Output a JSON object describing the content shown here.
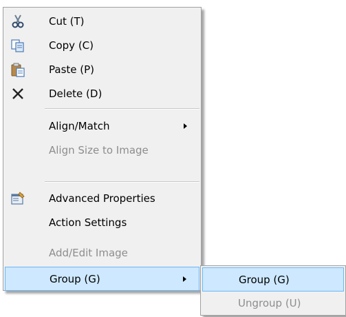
{
  "context_menu": {
    "items": [
      {
        "label": "Cut (T)",
        "icon": "scissors-icon"
      },
      {
        "label": "Copy (C)",
        "icon": "copy-icon"
      },
      {
        "label": "Paste (P)",
        "icon": "paste-icon"
      },
      {
        "label": "Delete (D)",
        "icon": "delete-x-icon"
      },
      {
        "label": "Align/Match",
        "submenu": true
      },
      {
        "label": "Align Size to Image",
        "disabled": true
      },
      {
        "label": "Advanced Properties",
        "icon": "properties-icon"
      },
      {
        "label": "Action Settings"
      },
      {
        "label": "Add/Edit Image",
        "disabled": true
      },
      {
        "label": "Group (G)",
        "submenu": true,
        "highlighted": true
      }
    ]
  },
  "submenu": {
    "items": [
      {
        "label": "Group (G)",
        "highlighted": true
      },
      {
        "label": "Ungroup (U)",
        "disabled": true
      }
    ]
  },
  "colors": {
    "menu_background": "#f0f0f0",
    "highlight_fill": "#cde8ff",
    "highlight_border": "#6cb6f5",
    "disabled_text": "#8d8d8d"
  }
}
